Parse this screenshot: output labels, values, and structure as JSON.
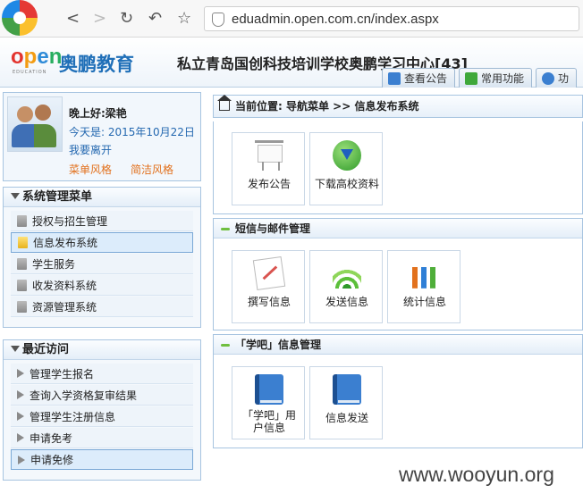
{
  "browser": {
    "url": "eduadmin.open.com.cn/index.aspx",
    "back": "<",
    "forward": ">",
    "reload": "↻",
    "undo": "↶",
    "star": "☆"
  },
  "header": {
    "logo_mark": [
      "o",
      "p",
      "e",
      "n"
    ],
    "logo_sub": "EDUCATION",
    "brand": "奥鹏教育",
    "school_title": "私立青岛国创科技培训学校奥鹏学习中心[43]",
    "tabs": [
      {
        "label": "查看公告",
        "icon_color": "#3b7fd0"
      },
      {
        "label": "常用功能",
        "icon_color": "#3fa83a"
      },
      {
        "label": "功",
        "icon_color": "#3b7fd0"
      }
    ]
  },
  "user": {
    "greeting": "晚上好:梁艳",
    "date": "今天是: 2015年10月22日",
    "leave": "我要离开",
    "style_menu": "菜单风格",
    "style_simple": "简洁风格"
  },
  "system_menu": {
    "title": "系统管理菜单",
    "items": [
      {
        "label": "授权与招生管理",
        "selected": false
      },
      {
        "label": "信息发布系统",
        "selected": true
      },
      {
        "label": "学生服务",
        "selected": false
      },
      {
        "label": "收发资料系统",
        "selected": false
      },
      {
        "label": "资源管理系统",
        "selected": false
      }
    ]
  },
  "recent": {
    "title": "最近访问",
    "items": [
      {
        "label": "管理学生报名",
        "selected": false
      },
      {
        "label": "查询入学资格复审结果",
        "selected": false
      },
      {
        "label": "管理学生注册信息",
        "selected": false
      },
      {
        "label": "申请免考",
        "selected": false
      },
      {
        "label": "申请免修",
        "selected": true
      }
    ]
  },
  "breadcrumb": "当前位置: 导航菜单 >> 信息发布系统",
  "sections": [
    {
      "title": "",
      "tiles": [
        {
          "label": "发布公告",
          "icon": "board-icon"
        },
        {
          "label": "下载高校资料",
          "icon": "globe-download-icon"
        }
      ]
    },
    {
      "title": "短信与邮件管理",
      "tiles": [
        {
          "label": "撰写信息",
          "icon": "pen-icon"
        },
        {
          "label": "发送信息",
          "icon": "signal-icon"
        },
        {
          "label": "统计信息",
          "icon": "chart-icon"
        }
      ]
    },
    {
      "title": "「学吧」信息管理",
      "tiles": [
        {
          "label": "「学吧」用户信息",
          "icon": "book-icon"
        },
        {
          "label": "信息发送",
          "icon": "book-icon"
        }
      ]
    }
  ],
  "watermark": "www.wooyun.org"
}
